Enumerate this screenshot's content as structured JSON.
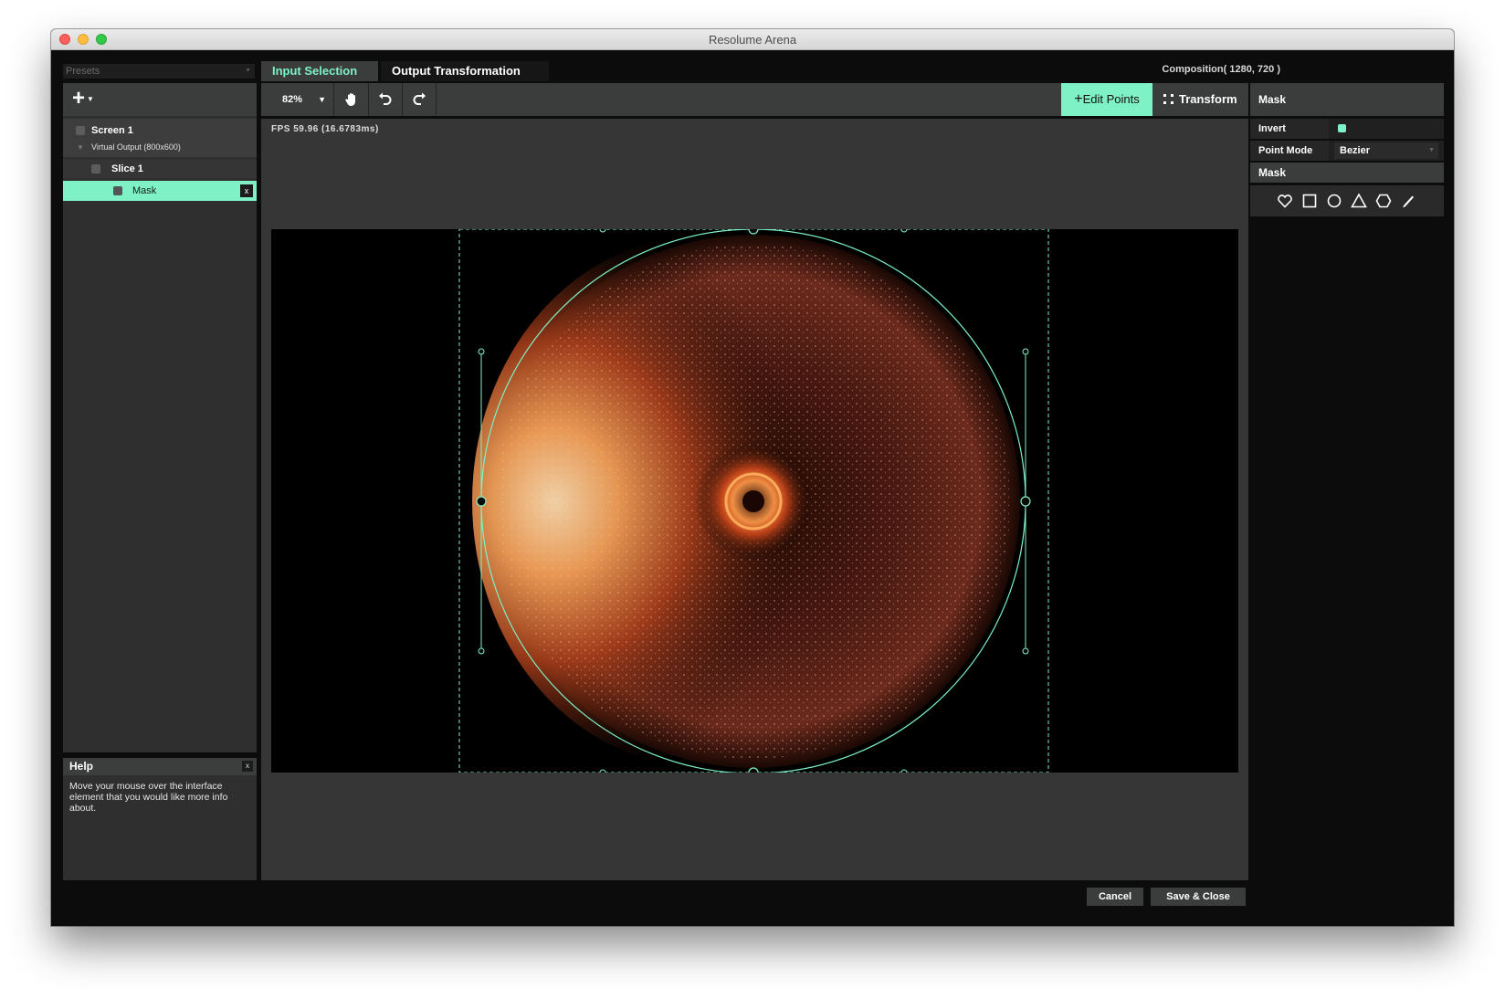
{
  "window": {
    "title": "Resolume Arena"
  },
  "presets": {
    "label": "Presets"
  },
  "tree": {
    "screen": "Screen 1",
    "output": "Virtual Output (800x600)",
    "slice": "Slice 1",
    "mask": "Mask",
    "remove_label": "x"
  },
  "tabs": {
    "input_selection": "Input Selection",
    "output_transformation": "Output Transformation"
  },
  "composition": "Composition( 1280, 720 )",
  "toolbar": {
    "zoom": "82%",
    "edit_points": "Edit Points",
    "transform": "Transform"
  },
  "stage": {
    "fps": "FPS 59.96 (16.6783ms)"
  },
  "help": {
    "title": "Help",
    "close": "x",
    "text": "Move your mouse over the interface element that you would like more info about."
  },
  "properties": {
    "header": "Mask",
    "invert_label": "Invert",
    "invert_checked": true,
    "point_mode_label": "Point Mode",
    "point_mode_value": "Bezier",
    "mask_section": "Mask",
    "shape_tools": [
      "heart-shape-icon",
      "square-shape-icon",
      "circle-shape-icon",
      "triangle-shape-icon",
      "hexagon-shape-icon",
      "pen-draw-icon"
    ]
  },
  "buttons": {
    "cancel": "Cancel",
    "save_close": "Save & Close"
  },
  "colors": {
    "accent": "#7ef2c6",
    "panel": "#3a3d3c",
    "background": "#0c0c0c"
  }
}
